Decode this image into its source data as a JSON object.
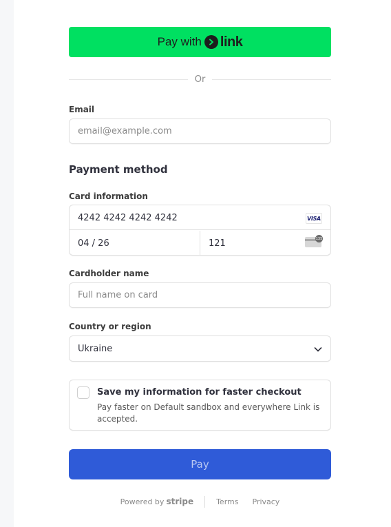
{
  "link_button": {
    "prefix": "Pay with",
    "brand": "link"
  },
  "divider_text": "Or",
  "email": {
    "label": "Email",
    "placeholder": "email@example.com",
    "value": ""
  },
  "payment_method": {
    "title": "Payment method",
    "card_label": "Card information",
    "card_number": "4242 4242 4242 4242",
    "card_brand": "VISA",
    "expiry": "04 / 26",
    "cvc": "121",
    "cvc_icon_text": "135"
  },
  "cardholder": {
    "label": "Cardholder name",
    "placeholder": "Full name on card",
    "value": ""
  },
  "country": {
    "label": "Country or region",
    "selected": "Ukraine"
  },
  "save_info": {
    "title": "Save my information for faster checkout",
    "description": "Pay faster on Default sandbox and everywhere Link is accepted.",
    "checked": false
  },
  "pay_button": {
    "label": "Pay"
  },
  "footer": {
    "powered_by": "Powered by",
    "brand": "stripe",
    "terms": "Terms",
    "privacy": "Privacy"
  },
  "colors": {
    "link_green": "#00e061",
    "pay_blue": "#2f5bd8"
  }
}
